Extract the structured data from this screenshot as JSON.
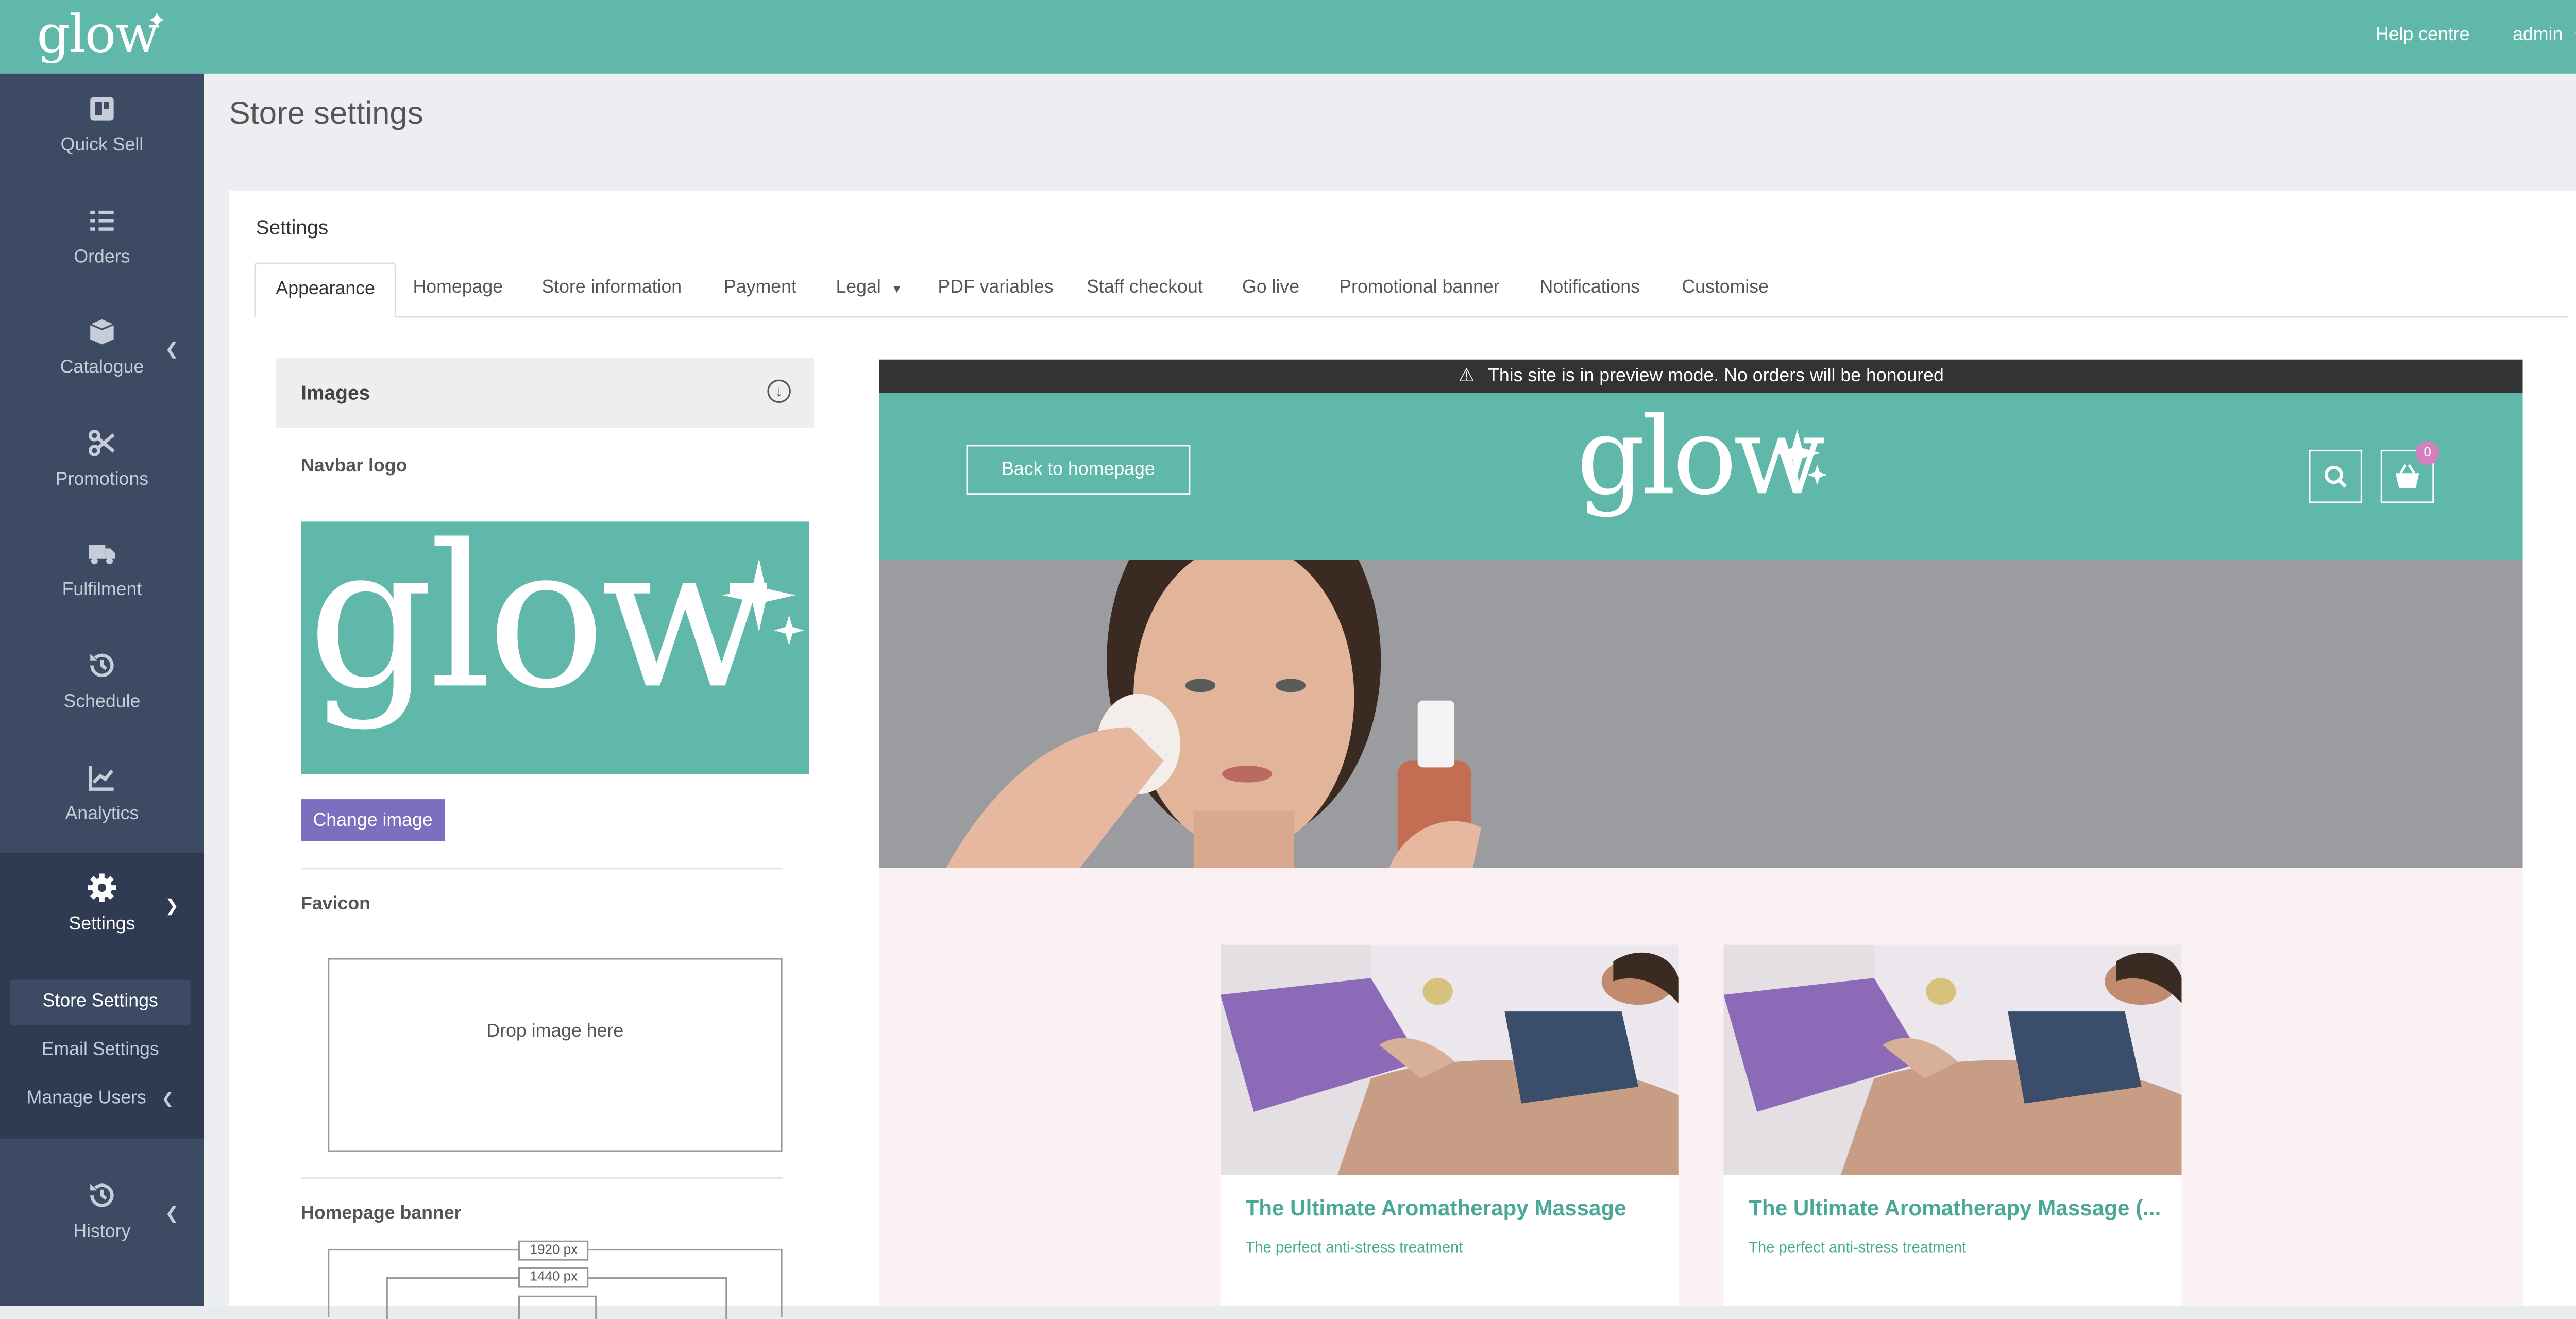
{
  "brand": {
    "logo_text": "glow"
  },
  "topbar": {
    "help_label": "Help centre",
    "user_label": "admin"
  },
  "sidebar": {
    "items": [
      {
        "label": "Quick Sell",
        "icon": "quick-sell-icon"
      },
      {
        "label": "Orders",
        "icon": "orders-icon"
      },
      {
        "label": "Catalogue",
        "icon": "catalogue-icon"
      },
      {
        "label": "Promotions",
        "icon": "scissors-icon"
      },
      {
        "label": "Fulfilment",
        "icon": "truck-icon"
      },
      {
        "label": "Schedule",
        "icon": "history-icon"
      },
      {
        "label": "Analytics",
        "icon": "chart-icon"
      },
      {
        "label": "Settings",
        "icon": "gear-icon"
      },
      {
        "label": "History",
        "icon": "history-icon"
      }
    ],
    "sub_items": [
      {
        "label": "Store Settings",
        "active": true
      },
      {
        "label": "Email Settings"
      },
      {
        "label": "Manage Users"
      }
    ]
  },
  "page": {
    "title": "Store settings",
    "panel_title": "Settings"
  },
  "tabs": [
    {
      "label": "Appearance",
      "active": true
    },
    {
      "label": "Homepage"
    },
    {
      "label": "Store information"
    },
    {
      "label": "Payment"
    },
    {
      "label": "Legal"
    },
    {
      "label": "PDF variables"
    },
    {
      "label": "Staff checkout"
    },
    {
      "label": "Go live"
    },
    {
      "label": "Promotional banner"
    },
    {
      "label": "Notifications"
    },
    {
      "label": "Customise"
    }
  ],
  "images_section": {
    "title": "Images",
    "navbar_logo_label": "Navbar logo",
    "change_image_label": "Change image",
    "favicon_label": "Favicon",
    "drop_text": "Drop image here",
    "homepage_banner_label": "Homepage banner",
    "banner_sizes": [
      "1920 px",
      "1440 px"
    ]
  },
  "preview": {
    "notice": "This site is in preview mode. No orders will be honoured",
    "back_label": "Back to homepage",
    "logo_text": "glow",
    "cart_count": "0",
    "cards": [
      {
        "title": "The Ultimate Aromatherapy Massage",
        "subtitle": "The perfect anti-stress treatment"
      },
      {
        "title": "The Ultimate Aromatherapy Massage (...",
        "subtitle": "The perfect anti-stress treatment"
      }
    ]
  },
  "colors": {
    "brand": "#60b8ab",
    "sidebar": "#3c4a63",
    "accent": "#7b6fbf",
    "badge": "#d47fc2"
  }
}
